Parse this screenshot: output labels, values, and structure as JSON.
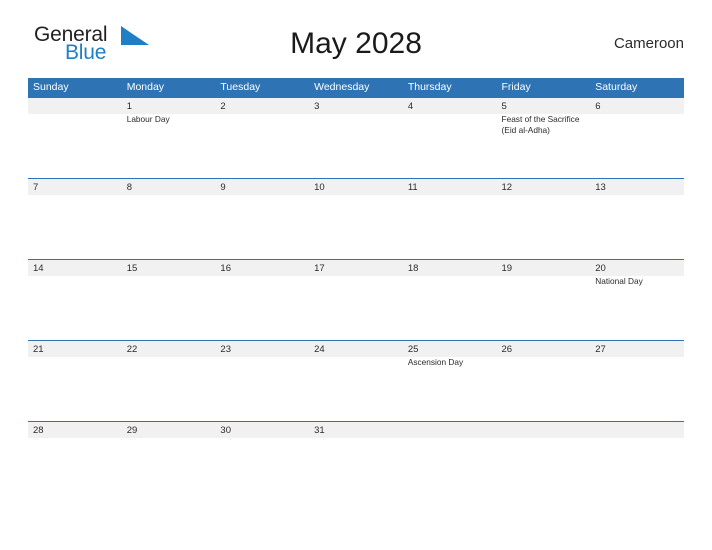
{
  "brand": {
    "name_part1": "General",
    "name_part2": "Blue",
    "triangle_icon": "blue-triangle-icon",
    "accent_color": "#1f7fc4"
  },
  "header": {
    "title": "May 2028",
    "country": "Cameroon"
  },
  "theme": {
    "header_blue": "#2e74b5",
    "day_band_gray": "#f1f1f1",
    "text_color": "#2b2b2b",
    "page_background": "#ffffff"
  },
  "calendar": {
    "month": "May",
    "year": "2028",
    "weekday_headers": [
      "Sunday",
      "Monday",
      "Tuesday",
      "Wednesday",
      "Thursday",
      "Friday",
      "Saturday"
    ],
    "weeks": [
      [
        {
          "day": "",
          "event": ""
        },
        {
          "day": "1",
          "event": "Labour Day"
        },
        {
          "day": "2",
          "event": ""
        },
        {
          "day": "3",
          "event": ""
        },
        {
          "day": "4",
          "event": ""
        },
        {
          "day": "5",
          "event": "Feast of the Sacrifice (Eid al-Adha)"
        },
        {
          "day": "6",
          "event": ""
        }
      ],
      [
        {
          "day": "7",
          "event": ""
        },
        {
          "day": "8",
          "event": ""
        },
        {
          "day": "9",
          "event": ""
        },
        {
          "day": "10",
          "event": ""
        },
        {
          "day": "11",
          "event": ""
        },
        {
          "day": "12",
          "event": ""
        },
        {
          "day": "13",
          "event": ""
        }
      ],
      [
        {
          "day": "14",
          "event": ""
        },
        {
          "day": "15",
          "event": ""
        },
        {
          "day": "16",
          "event": ""
        },
        {
          "day": "17",
          "event": ""
        },
        {
          "day": "18",
          "event": ""
        },
        {
          "day": "19",
          "event": ""
        },
        {
          "day": "20",
          "event": "National Day"
        }
      ],
      [
        {
          "day": "21",
          "event": ""
        },
        {
          "day": "22",
          "event": ""
        },
        {
          "day": "23",
          "event": ""
        },
        {
          "day": "24",
          "event": ""
        },
        {
          "day": "25",
          "event": "Ascension Day"
        },
        {
          "day": "26",
          "event": ""
        },
        {
          "day": "27",
          "event": ""
        }
      ],
      [
        {
          "day": "28",
          "event": ""
        },
        {
          "day": "29",
          "event": ""
        },
        {
          "day": "30",
          "event": ""
        },
        {
          "day": "31",
          "event": ""
        },
        {
          "day": "",
          "event": ""
        },
        {
          "day": "",
          "event": ""
        },
        {
          "day": "",
          "event": ""
        }
      ]
    ]
  }
}
